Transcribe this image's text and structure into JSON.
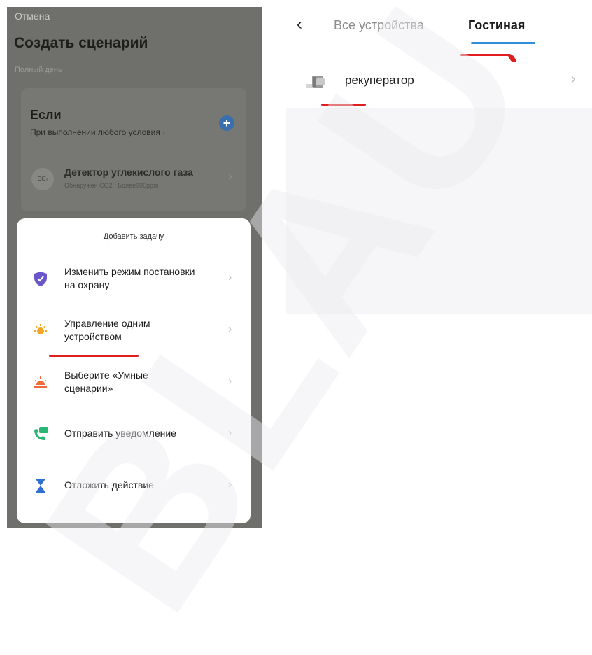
{
  "left": {
    "cancel": "Отмена",
    "title": "Создать сценарий",
    "subtitle": "Полный день",
    "condition": {
      "if_label": "Если",
      "if_desc": "При выполнении любого условия ·",
      "device_icon_text": "CO₂",
      "device_name": "Детектор углекислого газа",
      "device_sub": "Обнаружен CO2 : Более900ppm"
    },
    "sheet": {
      "title": "Добавить задачу",
      "items": [
        {
          "label": "Изменить режим постановки на охрану",
          "icon": "shield-icon"
        },
        {
          "label": "Управление одним устройством",
          "icon": "bulb-icon"
        },
        {
          "label": "Выберите «Умные сценарии»",
          "icon": "sunrise-icon"
        },
        {
          "label": "Отправить уведомление",
          "icon": "phone-message-icon"
        },
        {
          "label": "Отложить действие",
          "icon": "hourglass-icon"
        }
      ]
    }
  },
  "right": {
    "tabs": [
      "Все устройства",
      "Гостиная"
    ],
    "active_tab": "Гостиная",
    "device": "рекуператор"
  },
  "watermark": "BLAU",
  "colors": {
    "accent": "#2f8fd9",
    "annotation_red": "#e11e1e",
    "overlay": "#6f6f6c"
  }
}
